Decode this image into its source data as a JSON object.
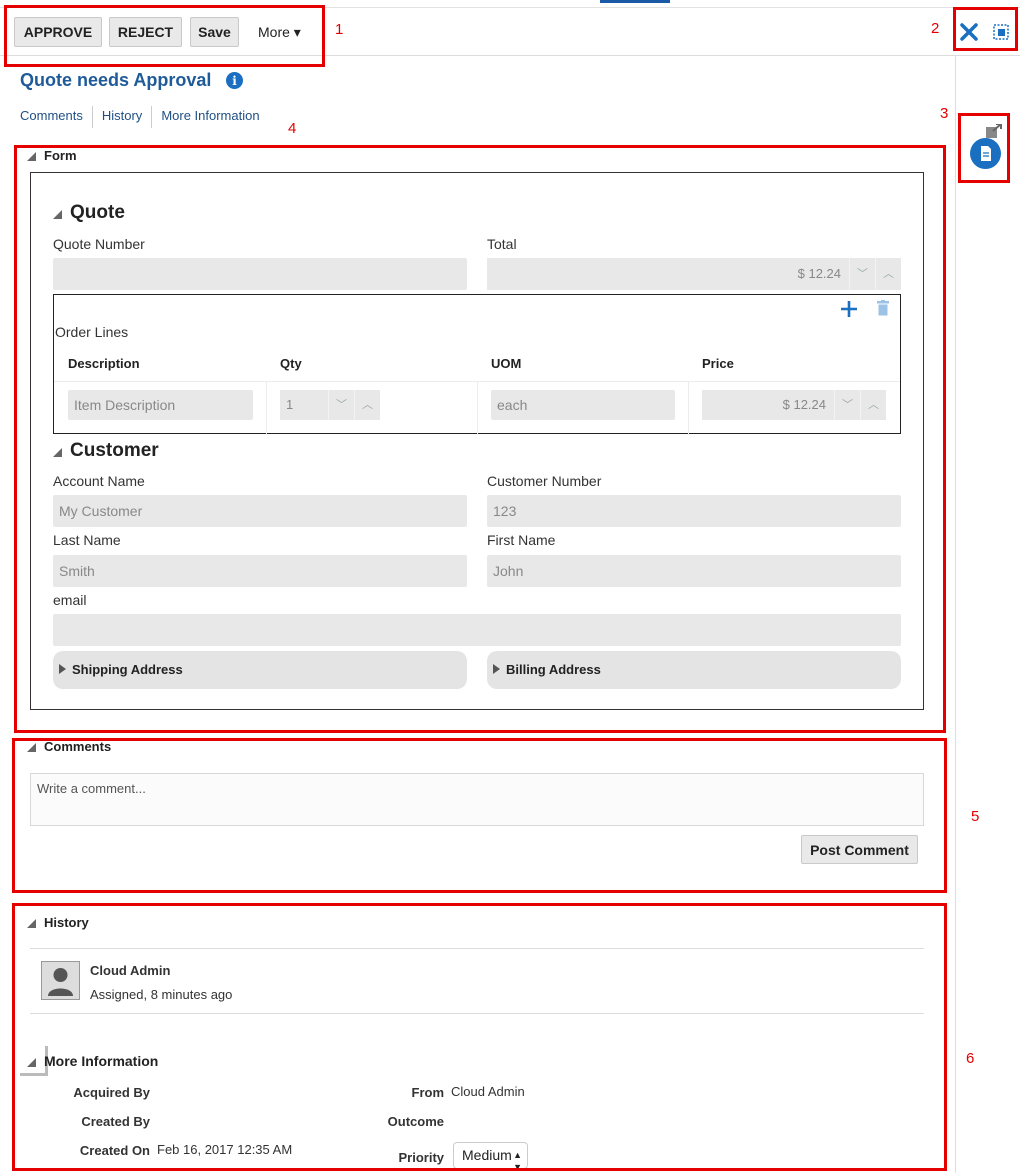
{
  "toolbar": {
    "approve_label": "APPROVE",
    "reject_label": "REJECT",
    "save_label": "Save",
    "more_label": "More ▾"
  },
  "annotations": [
    "1",
    "2",
    "3",
    "4",
    "5",
    "6"
  ],
  "header": {
    "title": "Quote needs Approval",
    "info_glyph": "i",
    "tabs": [
      "Comments",
      "History",
      "More Information"
    ]
  },
  "form": {
    "section_label": "Form",
    "quote": {
      "heading": "Quote",
      "quote_number_label": "Quote Number",
      "quote_number_value": "",
      "total_label": "Total",
      "total_value": "$ 12.24"
    },
    "order_lines": {
      "title": "Order Lines",
      "columns": [
        "Description",
        "Qty",
        "UOM",
        "Price"
      ],
      "row": {
        "description_placeholder": "Item Description",
        "qty": "1",
        "uom": "each",
        "price": "$ 12.24"
      }
    },
    "customer": {
      "heading": "Customer",
      "account_name_label": "Account Name",
      "account_name_value": "My Customer",
      "customer_number_label": "Customer Number",
      "customer_number_value": "123",
      "last_name_label": "Last Name",
      "last_name_value": "Smith",
      "first_name_label": "First Name",
      "first_name_value": "John",
      "email_label": "email",
      "email_value": "",
      "shipping_label": "Shipping Address",
      "billing_label": "Billing Address"
    }
  },
  "comments": {
    "section_label": "Comments",
    "placeholder": "Write a comment...",
    "post_label": "Post Comment"
  },
  "history": {
    "section_label": "History",
    "entries": [
      {
        "user": "Cloud Admin",
        "action": "Assigned,",
        "when": "8 minutes ago"
      }
    ]
  },
  "more_information": {
    "section_label": "More Information",
    "acquired_by_label": "Acquired By",
    "acquired_by_value": "",
    "created_by_label": "Created By",
    "created_by_value": "",
    "created_on_label": "Created On",
    "created_on_value": "Feb 16, 2017 12:35 AM",
    "from_label": "From",
    "from_value": "Cloud Admin",
    "outcome_label": "Outcome",
    "outcome_value": "",
    "priority_label": "Priority",
    "priority_value": "Medium"
  },
  "colors": {
    "accent": "#1f5b99",
    "annotation_red": "#e50000",
    "icon_blue": "#1a6fc0"
  },
  "icons": {
    "close": "close-icon",
    "maximize": "maximize-icon",
    "document": "document-icon",
    "expand": "expand-icon",
    "add": "add-icon",
    "delete": "trash-icon",
    "user": "user-avatar-icon"
  }
}
